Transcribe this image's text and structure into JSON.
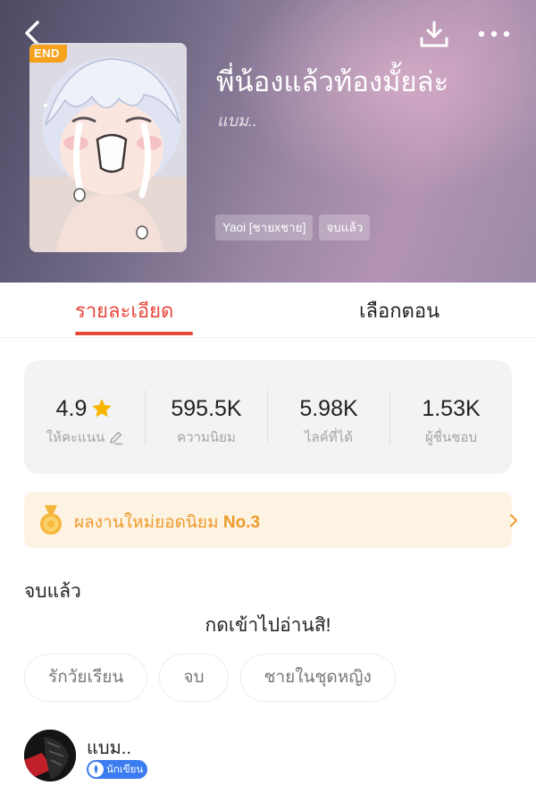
{
  "header": {
    "badge": "END",
    "title": "พี่น้องแล้วท้องมั้ยล่ะ",
    "author": "แบม..",
    "tags": [
      "Yaoi [ชายxชาย]",
      "จบแล้ว"
    ]
  },
  "tabs": [
    {
      "label": "รายละเอียด",
      "active": true
    },
    {
      "label": "เลือกตอน",
      "active": false
    }
  ],
  "stats": {
    "rating": {
      "value": "4.9",
      "label": "ให้คะแนน"
    },
    "popularity": {
      "value": "595.5K",
      "label": "ความนิยม"
    },
    "likes": {
      "value": "5.98K",
      "label": "ไลค์ที่ได้"
    },
    "fans": {
      "value": "1.53K",
      "label": "ผู้ชื่นชอบ"
    }
  },
  "award": {
    "text": "ผลงานใหม่ยอดนิยม",
    "rank": "No.3"
  },
  "status": "จบแล้ว",
  "description": "กดเข้าไปอ่านสิ!",
  "chips": [
    "รักวัยเรียน",
    "จบ",
    "ชายในชุดหญิง"
  ],
  "author_row": {
    "name": "แบม..",
    "badge": "นักเขียน"
  },
  "colors": {
    "accent": "#e8473b",
    "star": "#f7b500",
    "award_text": "#ee9a2a",
    "award_bg": "#fdf3e3",
    "writer_badge": "#3b7cf0"
  },
  "icons": {
    "back": "chevron-left-icon",
    "download": "download-icon",
    "more": "more-dots-icon",
    "star": "star-icon",
    "edit": "pencil-icon",
    "medal": "medal-icon",
    "chevron": "chevron-right-icon"
  }
}
